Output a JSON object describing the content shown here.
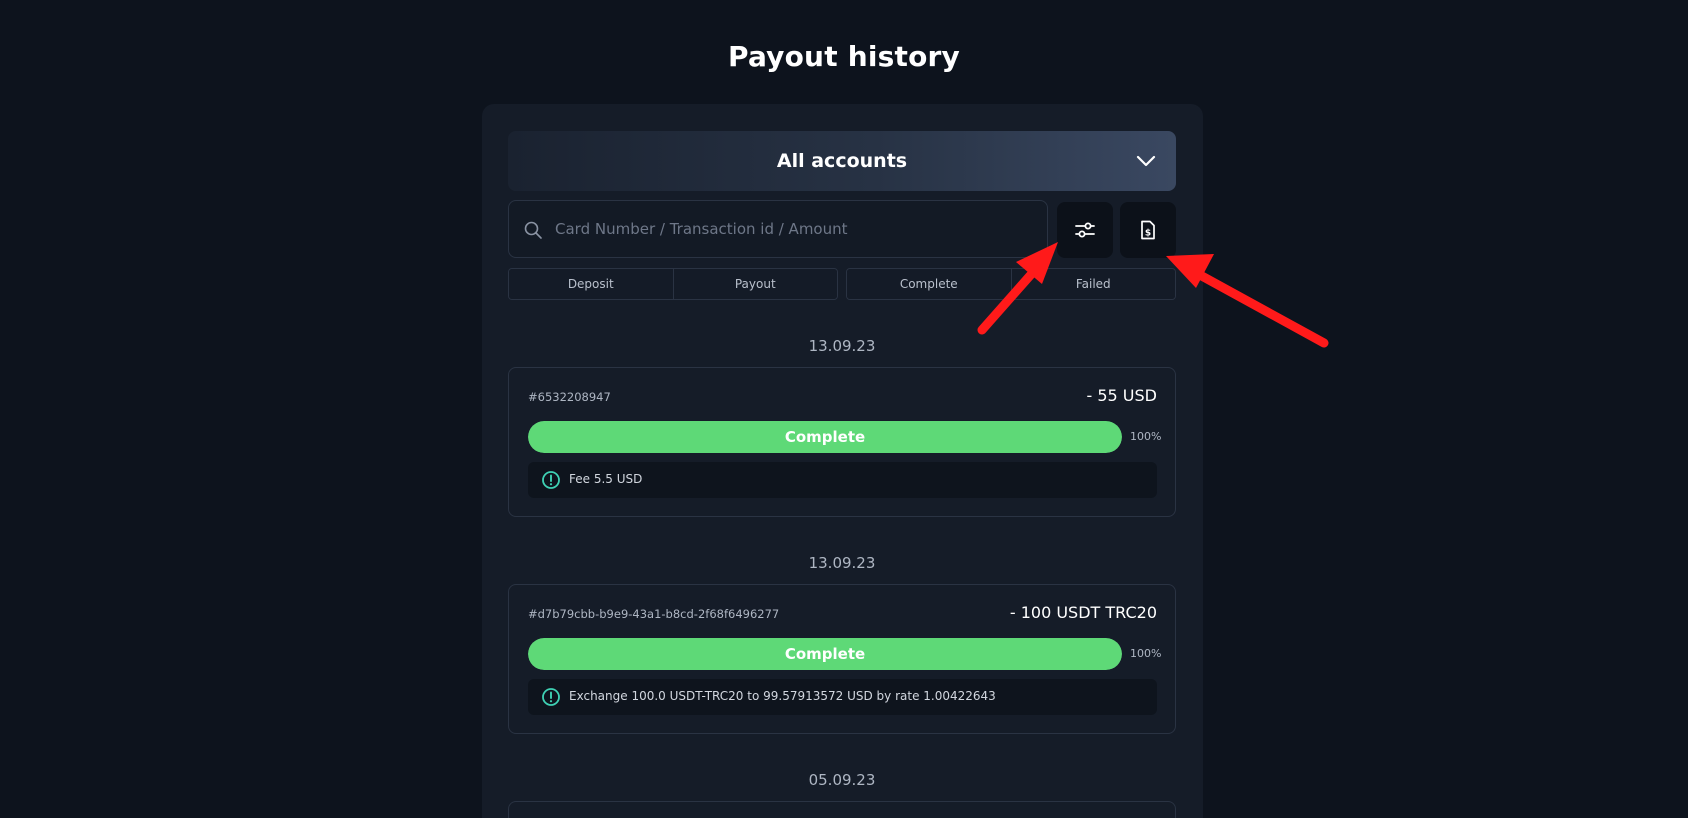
{
  "page": {
    "title": "Payout history"
  },
  "account_select": {
    "value": "All accounts",
    "chevron_icon": "chevron-down-icon"
  },
  "search": {
    "placeholder": "Card Number / Transaction id / Amount",
    "value": "",
    "icon": "search-icon"
  },
  "toolbar": {
    "filter_icon": "sliders-icon",
    "export_icon": "document-dollar-icon"
  },
  "filters": {
    "type_tabs": [
      "Deposit",
      "Payout"
    ],
    "status_tabs": [
      "Complete",
      "Failed"
    ]
  },
  "transactions": [
    {
      "date": "13.09.23",
      "id": "#6532208947",
      "amount": "- 55 USD",
      "status": "Complete",
      "progress_pct": 100,
      "progress_text": "100%",
      "note": "Fee 5.5 USD"
    },
    {
      "date": "13.09.23",
      "id": "#d7b79cbb-b9e9-43a1-b8cd-2f68f6496277",
      "amount": "- 100 USDT TRC20",
      "status": "Complete",
      "progress_pct": 100,
      "progress_text": "100%",
      "note": "Exchange 100.0 USDT-TRC20 to 99.57913572 USD by rate 1.00422643"
    },
    {
      "date": "05.09.23"
    }
  ],
  "colors": {
    "background": "#0d131d",
    "panel": "#151c28",
    "progress_complete": "#5ed977",
    "info_icon": "#3fd1b4",
    "annotation_arrow": "#ff1a1a"
  }
}
